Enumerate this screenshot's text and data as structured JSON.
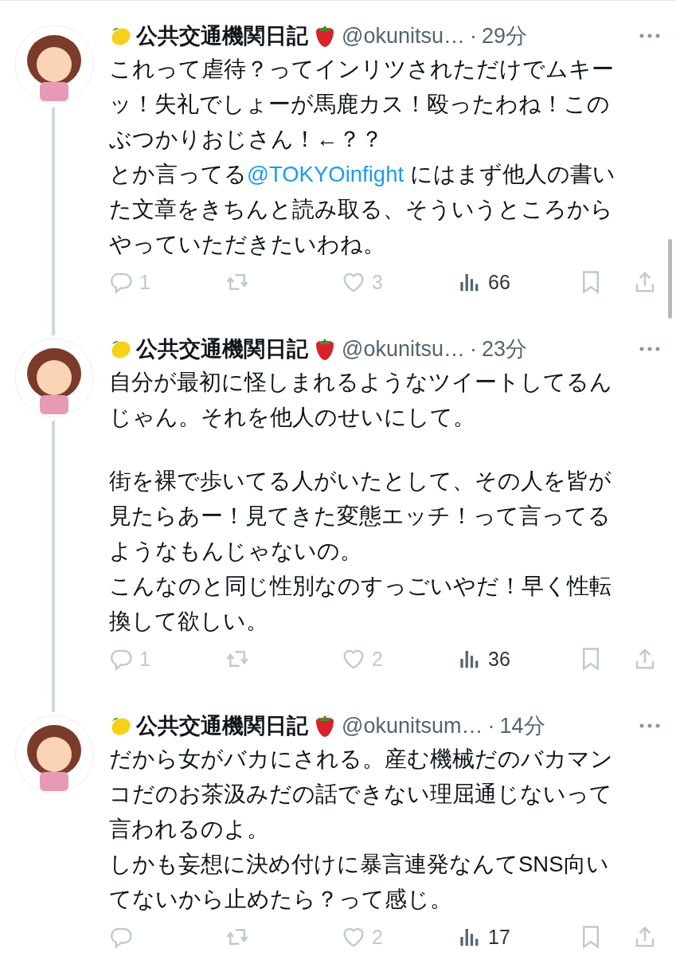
{
  "tweets": [
    {
      "name": "公共交通機関日記",
      "handle": "@okunitsu…",
      "separator": "·",
      "time": "29分",
      "thread_above": false,
      "thread_below": true,
      "paragraphs": [
        {
          "kind": "text",
          "segments": [
            {
              "kind": "text",
              "text": "これって虐待？ってインリツされただけでムキーッ！失礼でしょーが馬鹿カス！殴ったわね！このぶつかりおじさん！←？？"
            }
          ]
        },
        {
          "kind": "text",
          "segments": [
            {
              "kind": "text",
              "text": "とか言ってる"
            },
            {
              "kind": "mention",
              "text": "@TOKYOinfight"
            },
            {
              "kind": "text",
              "text": " にはまず他人の書いた文章をきちんと読み取る、そういうところからやっていただきたいわね。"
            }
          ]
        }
      ],
      "actions": [
        {
          "kind": "reply",
          "count": "1"
        },
        {
          "kind": "retweet"
        },
        {
          "kind": "like",
          "count": "3"
        },
        {
          "kind": "views",
          "count": "66"
        },
        {
          "kind": "bookmark"
        },
        {
          "kind": "share"
        }
      ]
    },
    {
      "name": "公共交通機関日記",
      "handle": "@okunitsu…",
      "separator": "·",
      "time": "23分",
      "thread_above": true,
      "thread_below": true,
      "paragraphs": [
        {
          "kind": "text",
          "segments": [
            {
              "kind": "text",
              "text": "自分が最初に怪しまれるようなツイートしてるんじゃん。それを他人のせいにして。"
            }
          ]
        },
        {
          "kind": "blank"
        },
        {
          "kind": "text",
          "segments": [
            {
              "kind": "text",
              "text": "街を裸で歩いてる人がいたとして、その人を皆が見たらあー！見てきた変態エッチ！って言ってるようなもんじゃないの。"
            }
          ]
        },
        {
          "kind": "text",
          "segments": [
            {
              "kind": "text",
              "text": "こんなのと同じ性別なのすっごいやだ！早く性転換して欲しい。"
            }
          ]
        }
      ],
      "actions": [
        {
          "kind": "reply",
          "count": "1"
        },
        {
          "kind": "retweet"
        },
        {
          "kind": "like",
          "count": "2"
        },
        {
          "kind": "views",
          "count": "36"
        },
        {
          "kind": "bookmark"
        },
        {
          "kind": "share"
        }
      ]
    },
    {
      "name": "公共交通機関日記",
      "handle": "@okunitsum…",
      "separator": "·",
      "time": "14分",
      "thread_above": true,
      "thread_below": false,
      "paragraphs": [
        {
          "kind": "text",
          "segments": [
            {
              "kind": "text",
              "text": "だから女がバカにされる。産む機械だのバカマンコだのお茶汲みだの話できない理屈通じないって言われるのよ。"
            }
          ]
        },
        {
          "kind": "text",
          "segments": [
            {
              "kind": "text",
              "text": "しかも妄想に決め付けに暴言連発なんてSNS向いてないから止めたら？って感じ。"
            }
          ]
        }
      ],
      "actions": [
        {
          "kind": "reply"
        },
        {
          "kind": "retweet"
        },
        {
          "kind": "like",
          "count": "2"
        },
        {
          "kind": "views",
          "count": "17"
        },
        {
          "kind": "bookmark"
        },
        {
          "kind": "share"
        }
      ]
    }
  ]
}
